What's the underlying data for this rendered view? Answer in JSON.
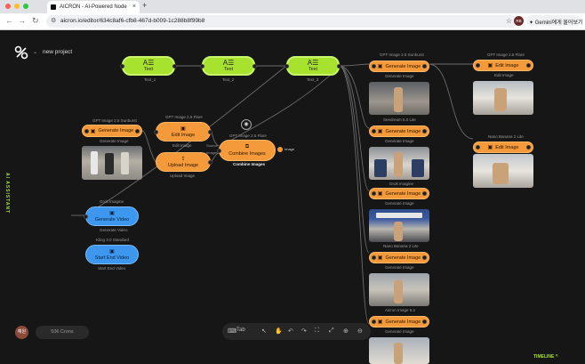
{
  "browser": {
    "tab_title": "AICRON - AI-Powered Node",
    "url": "aicron.io/editor/634c8af6-cfb8-467d-b009-1c288b8f99b8",
    "gemini_label": "Gemini에게 물어보기",
    "profile_initials": "RB"
  },
  "app": {
    "project_name": "new project",
    "assistant_label": "AI ASSISTANT",
    "user_avatar": "예원",
    "crons_label": "506 Crons",
    "tab_label": "Tab",
    "timeline_label": "TIMELINE"
  },
  "text_nodes": [
    {
      "label": "Text",
      "caption": "Text_1"
    },
    {
      "label": "Text",
      "caption": "Text_2"
    },
    {
      "label": "Text",
      "caption": "Text_3"
    }
  ],
  "left_nodes": {
    "gen_image": {
      "model": "GPT Image 2.5 Sunburst",
      "button": "Generate Image",
      "caption": "Generate Image"
    },
    "edit_image": {
      "model": "GPT Image 2.5 Flare",
      "button": "Edit Image",
      "caption": "Edit Image"
    },
    "upload_image": {
      "button": "Upload Image",
      "caption": "Upload Image"
    },
    "combine": {
      "model": "GPT Image 2.5 Flare",
      "button": "Combine Images",
      "caption": "Combine Images",
      "port_a": "Source",
      "port_b": "Images",
      "output": "Image"
    },
    "gen_video": {
      "model": "Grok Imagine",
      "button": "Generate Video",
      "caption": "Generate Video"
    },
    "start_end": {
      "model": "Kling 3.0 Standard",
      "button": "Start End Video",
      "caption": "Start End Video"
    }
  },
  "right_column": [
    {
      "model": "GPT Image 2.5 Sunburst",
      "button": "Generate Image",
      "caption": "Seedream 5.0 Lite"
    },
    {
      "model": "",
      "button": "Generate Image",
      "caption": "Grok Imagine"
    },
    {
      "model": "",
      "button": "Generate Image",
      "caption": "Nano Banana 2 Lite"
    },
    {
      "model": "",
      "button": "Generate Image",
      "caption": "Aicron Image 6.2"
    },
    {
      "model": "",
      "button": "Generate Image",
      "caption": "Generate Image"
    }
  ],
  "right_sub_captions": [
    "Generate Image",
    "Generate Image",
    "Generate Image",
    "Generate Image",
    "Generate Image"
  ],
  "far_right": [
    {
      "model": "GPT Image 2.5 Flare",
      "button": "Edit Image",
      "caption": "Edit Image"
    },
    {
      "model": "Nano Banana 2 Lite",
      "button": "Edit Image",
      "caption": ""
    }
  ],
  "colors": {
    "green": "#a6e22e",
    "orange": "#f49a3a",
    "blue": "#3d97ef",
    "bg": "#161616"
  }
}
